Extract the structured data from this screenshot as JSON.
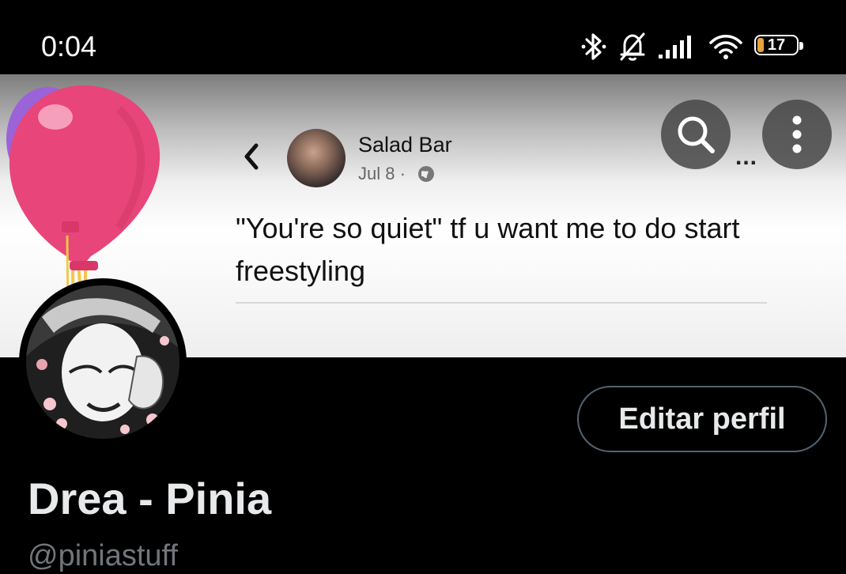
{
  "status_bar": {
    "time": "0:04",
    "battery_level": "17",
    "battery_fraction": 0.17,
    "icons": [
      "bluetooth-icon",
      "bell-off-icon",
      "signal-icon",
      "wifi-icon",
      "battery-icon"
    ]
  },
  "banner": {
    "post": {
      "author": "Salad Bar",
      "date": "Jul 8 ·",
      "text": "\"You're so quiet\" tf u want me to do start freestyling",
      "more": "..."
    }
  },
  "header_actions": {
    "search_icon": "search-icon",
    "more_icon": "more-vertical-icon"
  },
  "profile": {
    "edit_button_label": "Editar perfil",
    "display_name": "Drea - Pinia",
    "handle": "@piniastuff"
  },
  "colors": {
    "background": "#000000",
    "balloon": "#e8457a",
    "battery_fill": "#e5a43b",
    "button_border": "#536471",
    "handle": "#71767b"
  }
}
